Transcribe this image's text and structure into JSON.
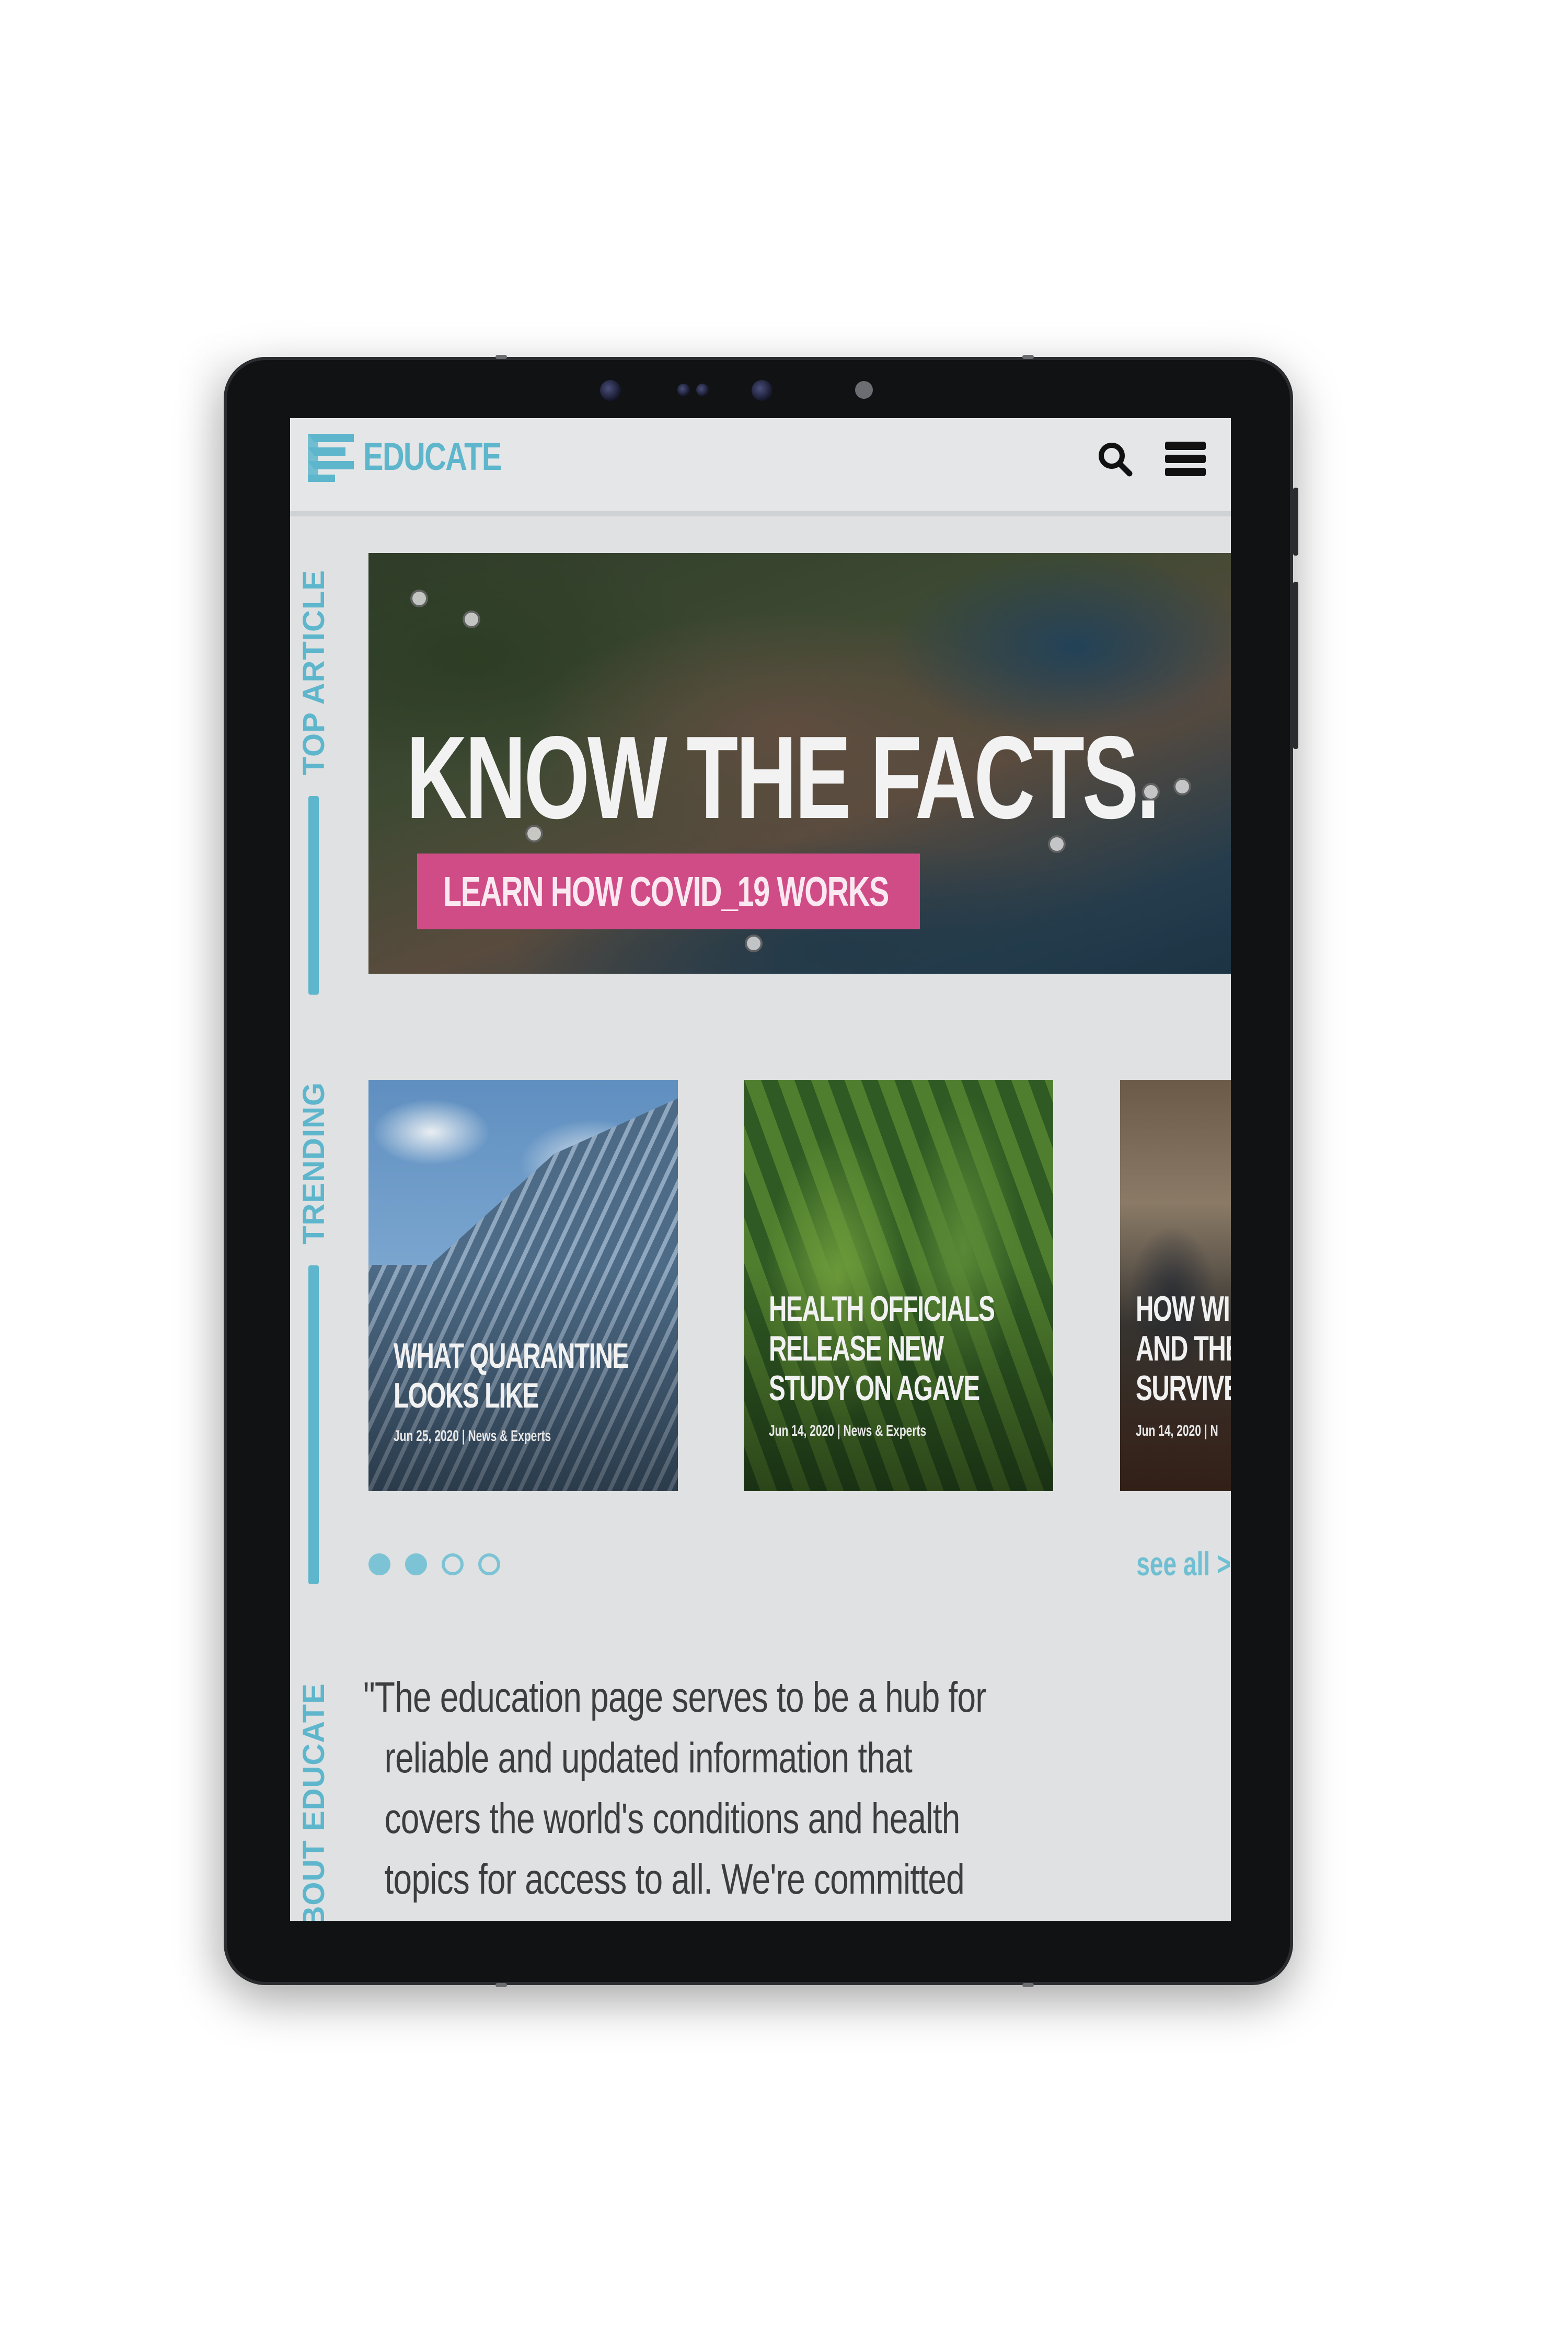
{
  "header": {
    "brand": "EDUCATE",
    "search_icon": "search-icon",
    "menu_icon": "hamburger-menu-icon"
  },
  "sections": {
    "top_article": "TOP ARTICLE",
    "trending": "TRENDING",
    "about": "ABOUT EDUCATE"
  },
  "hero": {
    "title": "KNOW THE FACTS.",
    "cta_label": "LEARN HOW COVID_19 WORKS"
  },
  "trending": {
    "cards": [
      {
        "title_line1": "WHAT QUARANTINE",
        "title_line2": "LOOKS LIKE",
        "meta": "Jun 25, 2020 | News & Experts"
      },
      {
        "title_line1": "HEALTH OFFICIALS",
        "title_line2": "RELEASE NEW",
        "title_line3": "STUDY ON AGAVE",
        "meta": "Jun 14, 2020 | News & Experts"
      },
      {
        "title_line1": "HOW WI",
        "title_line2": "AND THE",
        "title_line3": "SURVIVE",
        "meta": "Jun 14, 2020 | N"
      }
    ],
    "pager": {
      "total": 4,
      "active": 2
    },
    "see_all": "see all >"
  },
  "about": {
    "lines": [
      "\"The education page serves to be a hub for",
      "reliable and updated information that",
      "covers the world's conditions and health",
      "topics for access to all. We're committed"
    ]
  },
  "colors": {
    "accent": "#5eb6cc",
    "cta": "#d04c86",
    "screen_bg": "#dfe1e2",
    "frame": "#111214"
  }
}
